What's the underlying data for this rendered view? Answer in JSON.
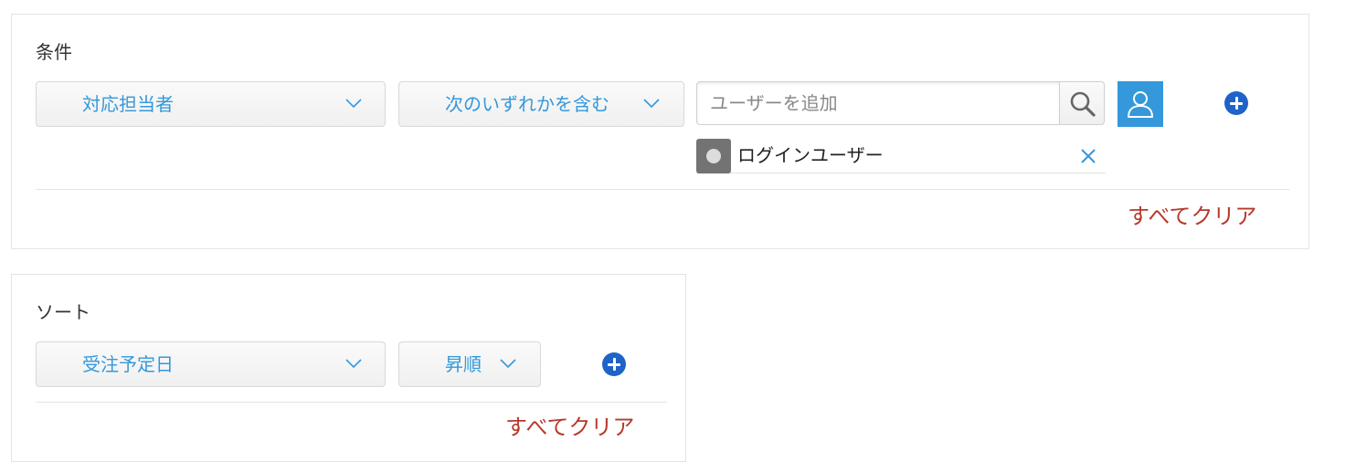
{
  "filter": {
    "title": "条件",
    "field_select": {
      "value": "対応担当者"
    },
    "operator_select": {
      "value": "次のいずれかを含む"
    },
    "user_input": {
      "placeholder": "ユーザーを追加",
      "value": ""
    },
    "selected_users": [
      {
        "label": "ログインユーザー"
      }
    ],
    "clear_all_label": "すべてクリア"
  },
  "sort": {
    "title": "ソート",
    "field_select": {
      "value": "受注予定日"
    },
    "order_select": {
      "value": "昇順"
    },
    "clear_all_label": "すべてクリア"
  },
  "icons": {
    "dropdown": "chevron-down-icon",
    "search": "search-icon",
    "user_picker": "user-icon",
    "add": "plus-circle-icon",
    "remove": "close-icon",
    "avatar": "user-avatar-icon"
  },
  "colors": {
    "accent": "#3498db",
    "add_button": "#1f63c9",
    "clear_link": "#b7392c",
    "border": "#e3e3e3",
    "avatar_bg": "#737373"
  }
}
